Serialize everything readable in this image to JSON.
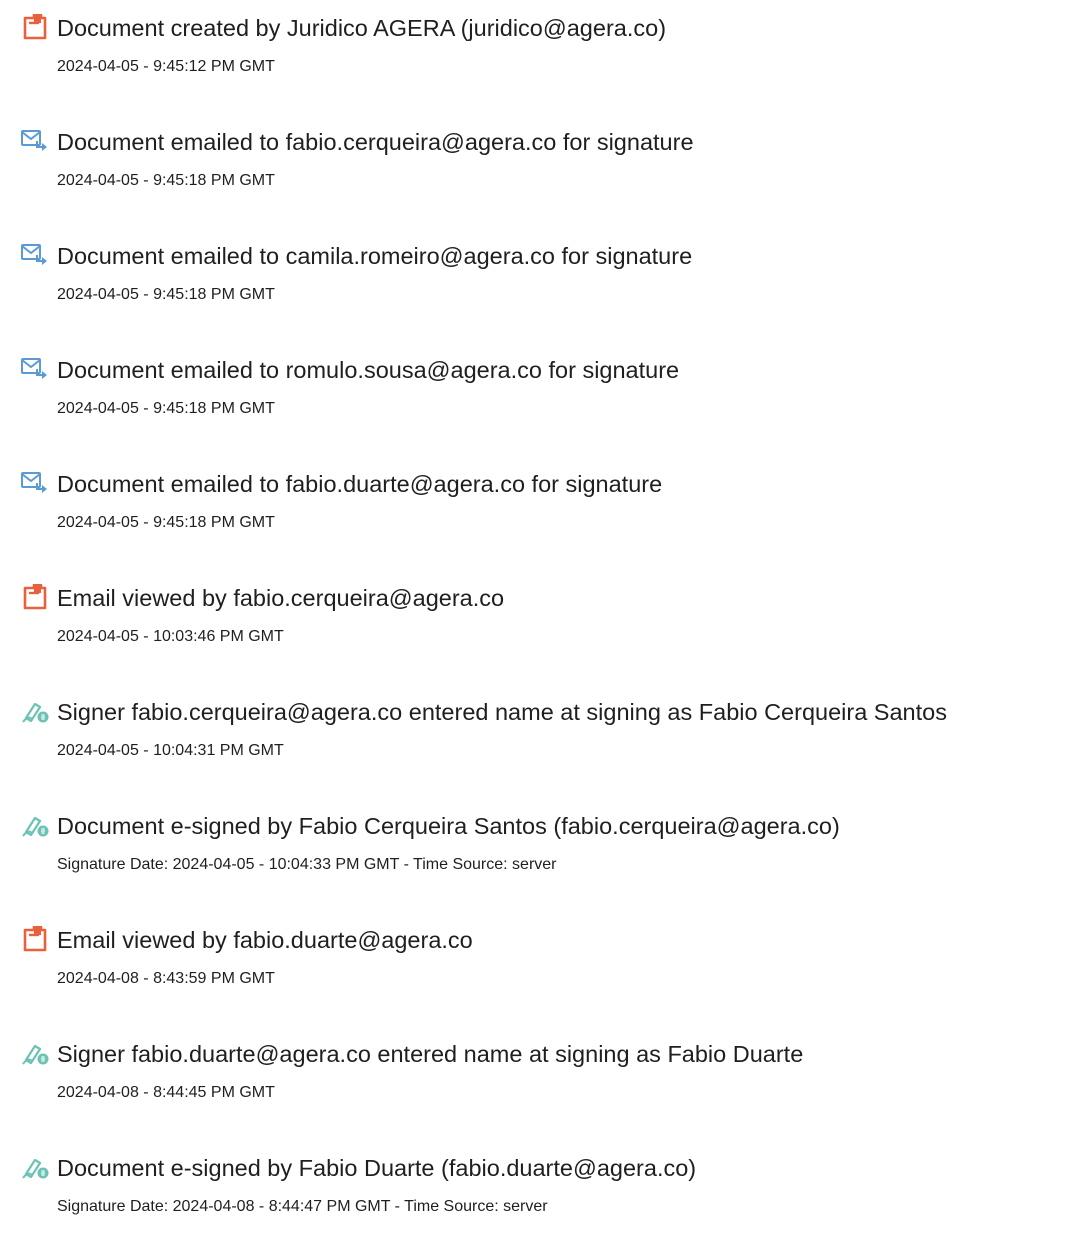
{
  "events": [
    {
      "icon": "document-created-icon",
      "title": "Document created by Juridico AGERA (juridico@agera.co)",
      "detail": "2024-04-05 - 9:45:12 PM GMT"
    },
    {
      "icon": "email-sent-icon",
      "title": "Document emailed to fabio.cerqueira@agera.co for signature",
      "detail": "2024-04-05 - 9:45:18 PM GMT"
    },
    {
      "icon": "email-sent-icon",
      "title": "Document emailed to camila.romeiro@agera.co for signature",
      "detail": "2024-04-05 - 9:45:18 PM GMT"
    },
    {
      "icon": "email-sent-icon",
      "title": "Document emailed to romulo.sousa@agera.co for signature",
      "detail": "2024-04-05 - 9:45:18 PM GMT"
    },
    {
      "icon": "email-sent-icon",
      "title": "Document emailed to fabio.duarte@agera.co for signature",
      "detail": "2024-04-05 - 9:45:18 PM GMT"
    },
    {
      "icon": "document-viewed-icon",
      "title": "Email viewed by fabio.cerqueira@agera.co",
      "detail": "2024-04-05 - 10:03:46 PM GMT"
    },
    {
      "icon": "e-sign-pen-icon",
      "title": "Signer fabio.cerqueira@agera.co entered name at signing as Fabio Cerqueira Santos",
      "detail": "2024-04-05 - 10:04:31 PM GMT"
    },
    {
      "icon": "e-sign-pen-icon",
      "title": "Document e-signed by Fabio Cerqueira Santos (fabio.cerqueira@agera.co)",
      "detail": "Signature Date: 2024-04-05 - 10:04:33 PM GMT - Time Source: server"
    },
    {
      "icon": "document-viewed-icon",
      "title": "Email viewed by fabio.duarte@agera.co",
      "detail": "2024-04-08 - 8:43:59 PM GMT"
    },
    {
      "icon": "e-sign-pen-icon",
      "title": "Signer fabio.duarte@agera.co entered name at signing as Fabio Duarte",
      "detail": "2024-04-08 - 8:44:45 PM GMT"
    },
    {
      "icon": "e-sign-pen-icon",
      "title": "Document e-signed by Fabio Duarte (fabio.duarte@agera.co)",
      "detail": "Signature Date: 2024-04-08 - 8:44:47 PM GMT - Time Source: server"
    }
  ],
  "colors": {
    "document_icon": "#e8603c",
    "email_icon": "#5b9bd5",
    "sign_icon": "#6cc3b4",
    "text": "#1f1f1f"
  }
}
